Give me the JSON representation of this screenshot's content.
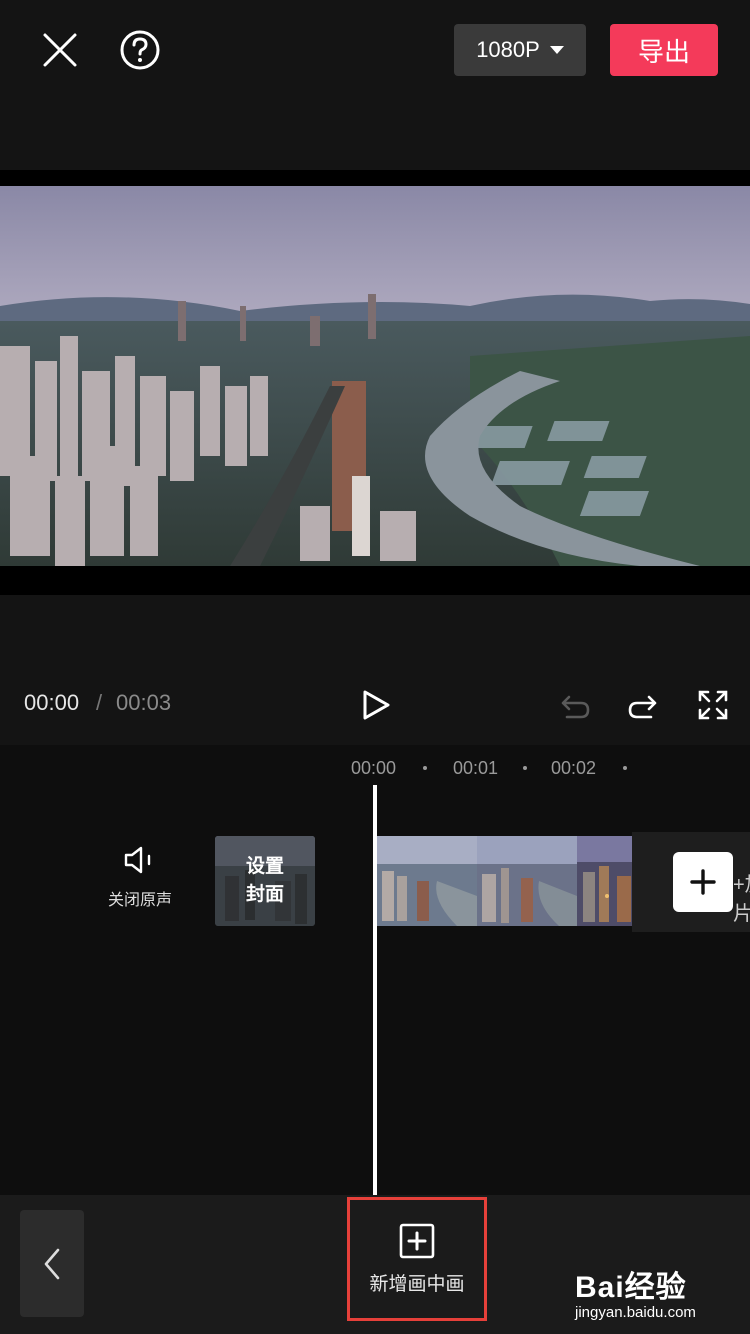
{
  "header": {
    "resolution_label": "1080P",
    "export_label": "导出"
  },
  "player": {
    "current_time": "00:00",
    "separator": "/",
    "total_time": "00:03"
  },
  "timeline": {
    "ruler": [
      "00:00",
      "00:01",
      "00:02"
    ],
    "mute_label": "关闭原声",
    "cover_label_line1": "设置",
    "cover_label_line2": "封面",
    "add_tail_text": "+加片"
  },
  "toolbar": {
    "pip_label": "新增画中画"
  },
  "watermark": {
    "main": "Bai经验",
    "sub": "jingyan.baidu.com"
  },
  "colors": {
    "accent": "#f43a5a",
    "highlight_box": "#e6403a",
    "background": "#0e0e0e"
  }
}
